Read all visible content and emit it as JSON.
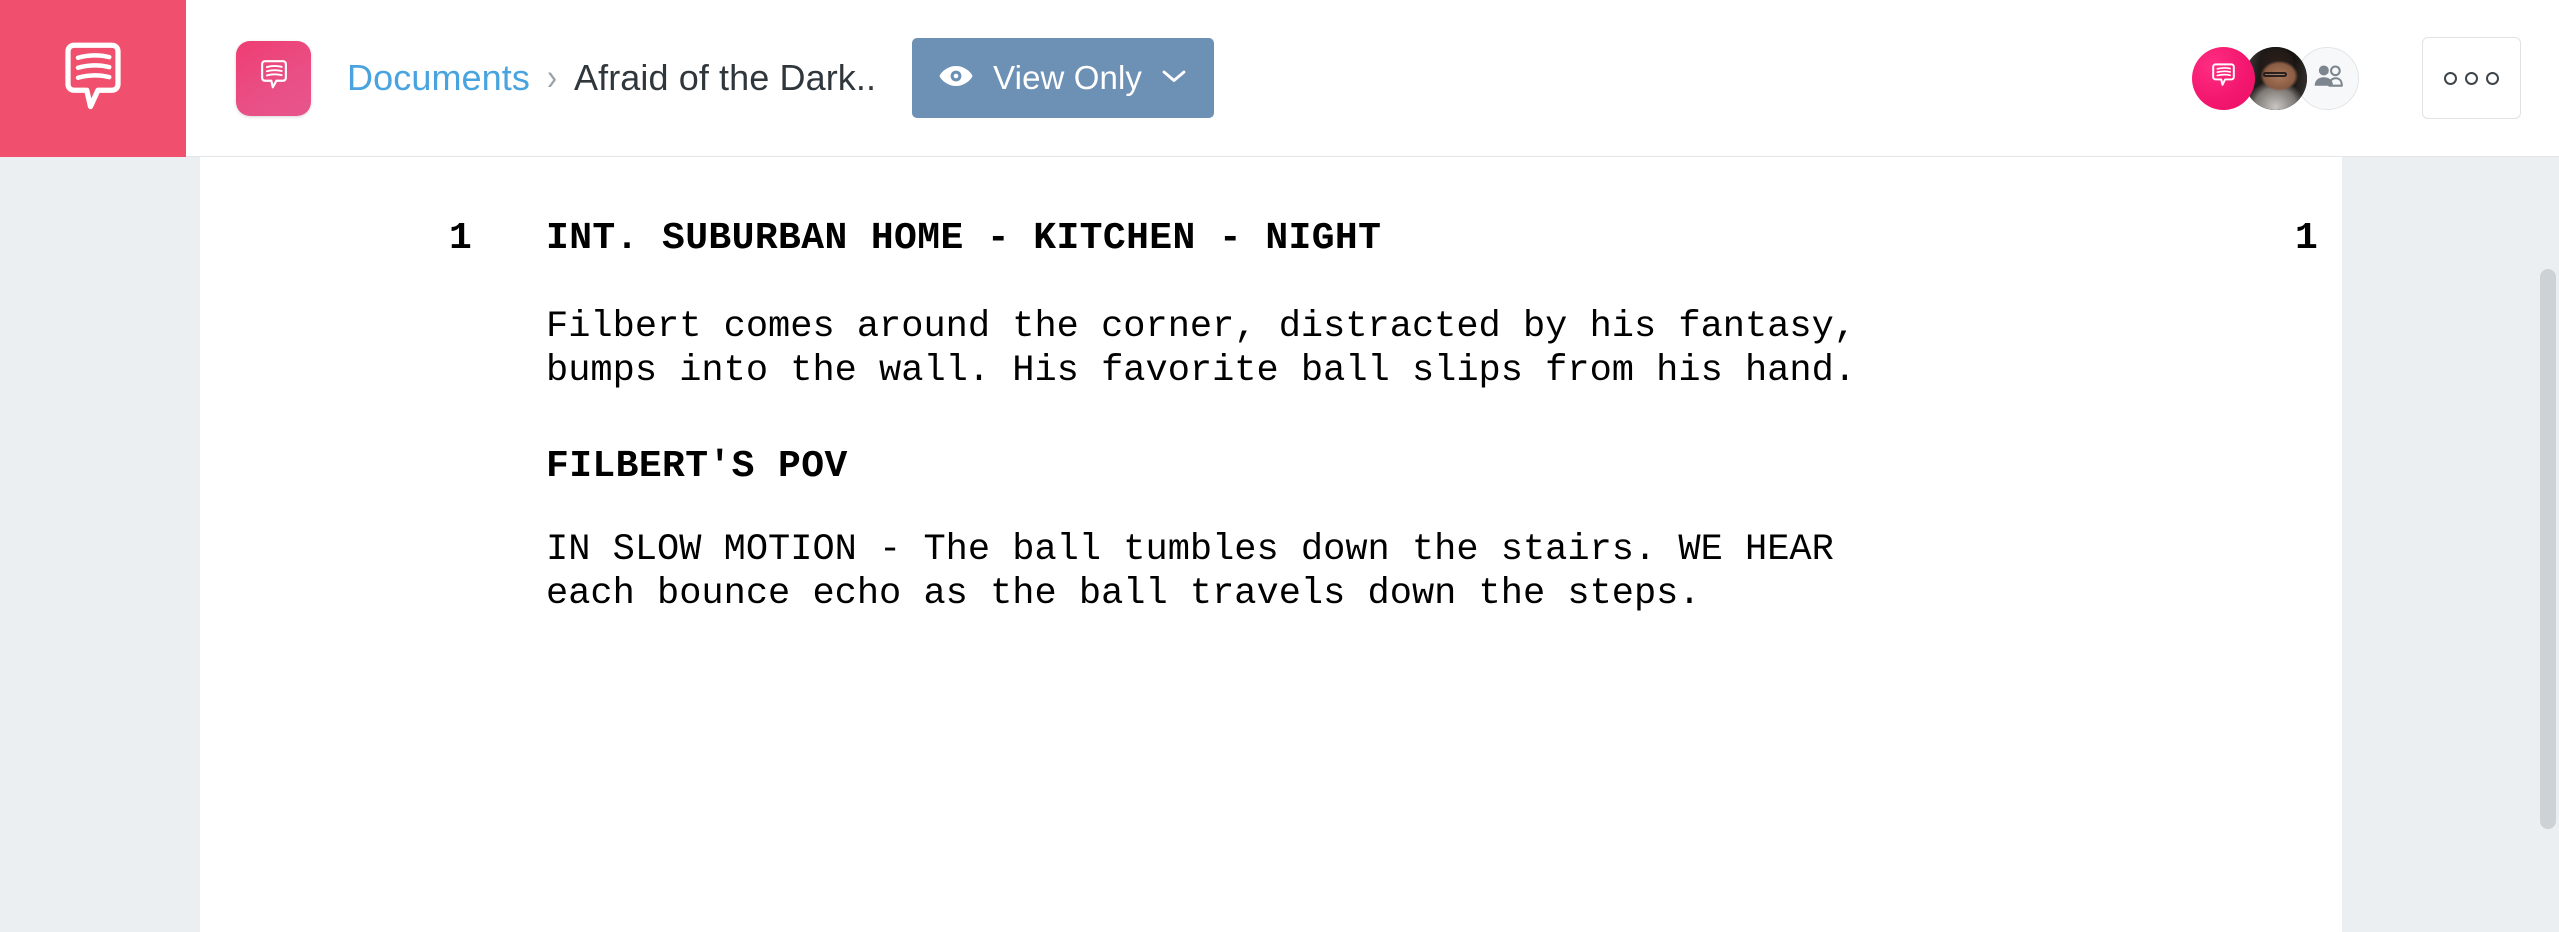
{
  "app": {
    "brand_color": "#f0506d",
    "accent_link_color": "#48a3de",
    "view_button_color": "#6d90b5",
    "page_background": "#eceff1"
  },
  "header": {
    "logo_icon": "speech-bubble-script-icon",
    "document_tile_icon": "speech-bubble-script-icon",
    "breadcrumb": {
      "parent_label": "Documents",
      "separator": "›",
      "current_label": "Afraid of the Dark.."
    },
    "view_mode_button": {
      "icon": "eye-icon",
      "label": "View Only",
      "chevron": "chevron-down-icon"
    },
    "avatars": [
      {
        "type": "comment-badge",
        "icon": "speech-bubble-icon"
      },
      {
        "type": "user-photo",
        "icon": "user-photo-avatar"
      },
      {
        "type": "add-people",
        "icon": "people-add-icon"
      }
    ],
    "overflow_button": {
      "icon": "three-circles-icon",
      "label": "○○○"
    }
  },
  "script": {
    "scene": {
      "number_left": "1",
      "number_right": "1",
      "heading": "INT. SUBURBAN HOME - KITCHEN - NIGHT"
    },
    "blocks": [
      {
        "type": "action",
        "text": "Filbert comes around the corner, distracted by his fantasy,\nbumps into the wall. His favorite ball slips from his hand."
      },
      {
        "type": "shot-heading",
        "text": "FILBERT'S POV"
      },
      {
        "type": "action",
        "text": "IN SLOW MOTION - The ball tumbles down the stairs. WE HEAR\neach bounce echo as the ball travels down the steps."
      }
    ]
  }
}
